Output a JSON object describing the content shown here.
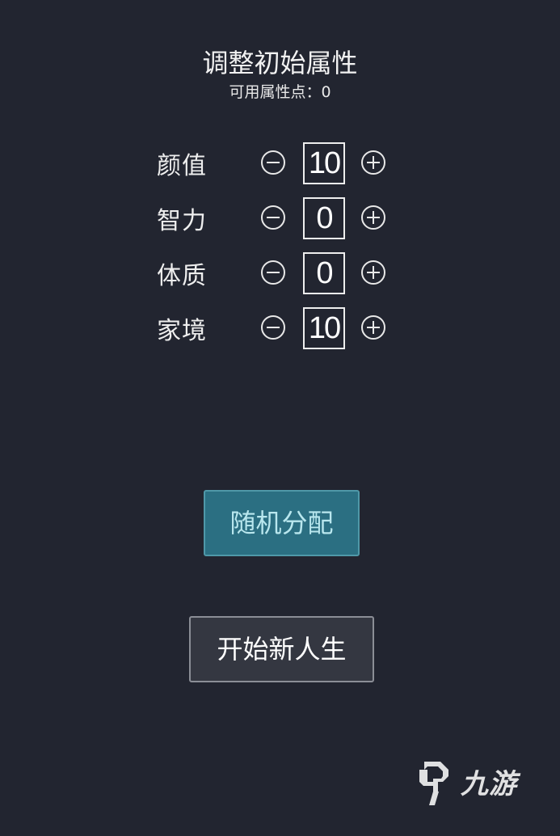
{
  "header": {
    "title": "调整初始属性",
    "subtitle": "可用属性点：0"
  },
  "attributes": [
    {
      "label": "颜值",
      "value": "10"
    },
    {
      "label": "智力",
      "value": "0"
    },
    {
      "label": "体质",
      "value": "0"
    },
    {
      "label": "家境",
      "value": "10"
    }
  ],
  "buttons": {
    "random_label": "随机分配",
    "start_label": "开始新人生"
  },
  "watermark": {
    "text": "九游"
  },
  "colors": {
    "background": "#222530",
    "random_button": "#2b6f82",
    "start_button": "#343741"
  },
  "icons": {
    "decrease": "minus-circle-icon",
    "increase": "plus-circle-icon"
  }
}
